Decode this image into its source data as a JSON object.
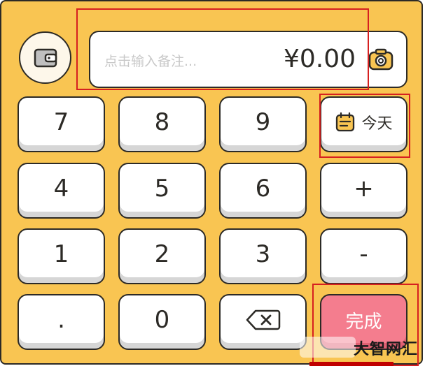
{
  "memo": {
    "placeholder": "点击输入备注...",
    "amount": "¥0.00"
  },
  "keys": {
    "k7": "7",
    "k8": "8",
    "k9": "9",
    "today": "今天",
    "k4": "4",
    "k5": "5",
    "k6": "6",
    "plus": "+",
    "k1": "1",
    "k2": "2",
    "k3": "3",
    "minus": "-",
    "dot": ".",
    "k0": "0",
    "done": "完成"
  },
  "icons": {
    "wallet": "wallet-icon",
    "camera": "camera-icon",
    "calendar": "calendar-icon",
    "backspace": "backspace-icon"
  },
  "colors": {
    "background": "#f9c552",
    "key": "#ffffff",
    "done": "#f47d8e",
    "annotation": "#d62020"
  },
  "watermark": {
    "text": "大智网汇"
  }
}
